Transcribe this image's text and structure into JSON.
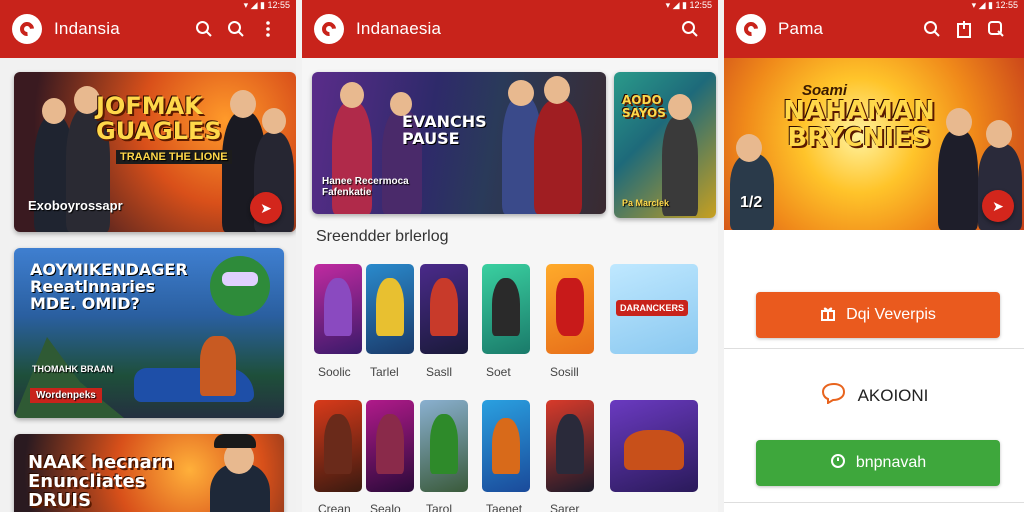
{
  "screen1": {
    "status_icons": "▾ ◢ ▮ 12:55",
    "title": "Indansia",
    "banners": [
      {
        "headline": "JOFMAK GUAGLES",
        "sub": "TRAANE THE LIONE",
        "caption": "Exoboyrossapr"
      },
      {
        "headline": "AOYMIKENDAGER Reeatlnnaries MDE. OMID?",
        "sub": "THOMAHK BRAAN",
        "caption": "Wordenpeks"
      },
      {
        "headline": "NAAK hecnarn Enuncliates DRUIS",
        "sub": "",
        "caption": ""
      }
    ]
  },
  "screen2": {
    "status_icons": "▾ ◢ ▮ 12:55",
    "title": "Indanaesia",
    "banner_main": {
      "headline": "EVANCHS PAUSE",
      "caption": "Hanee Recermoca Fafenkatie"
    },
    "banner_side": {
      "headline": "AODO SAYOS",
      "caption": "Pa Marclek"
    },
    "section_title": "Sreendder brlerlog",
    "row1_labels": [
      "Soolic",
      "Tarlel",
      "Sasll",
      "Soet",
      "Sosill"
    ],
    "row1_art_text": [
      "",
      "",
      "",
      "",
      "",
      "DARANCKERS"
    ],
    "row2_labels": [
      "Crean",
      "Sealo",
      "Tarol",
      "Taenet",
      "Sarer"
    ]
  },
  "screen3": {
    "status_icons": "▾ ◢ ▮ 12:55",
    "title": "Pama",
    "banner": {
      "top": "Soami",
      "headline": "NAHAMAN BRYCNIES",
      "page": "1/2"
    },
    "btn_orange": "Dqi Veverpis",
    "link_text": "AKOIONI",
    "btn_green": "bnpnavah"
  },
  "colors": {
    "appbar": "#c8231b",
    "orange": "#ea5a1e",
    "green": "#3ea73c"
  }
}
